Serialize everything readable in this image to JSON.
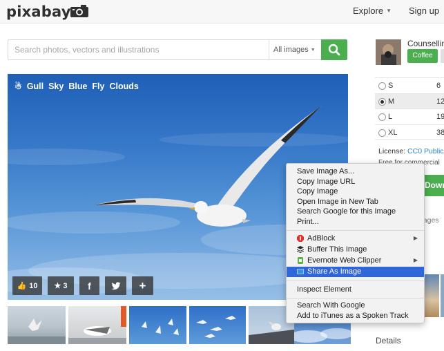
{
  "header": {
    "logo_text": "pixabay",
    "nav": {
      "explore_label": "Explore",
      "signup_label": "Sign up"
    }
  },
  "search": {
    "placeholder": "Search photos, vectors and illustrations",
    "type_label": "All images"
  },
  "image": {
    "tags": [
      "Gull",
      "Sky",
      "Blue",
      "Fly",
      "Clouds"
    ],
    "likes": "10",
    "favorites": "3",
    "facebook_label": "f",
    "add_label": "+"
  },
  "author": {
    "name": "Counsellin",
    "coffee_label": "Coffee"
  },
  "sizes": [
    {
      "label": "S",
      "value": "6"
    },
    {
      "label": "M",
      "value": "12"
    },
    {
      "label": "L",
      "value": "19"
    },
    {
      "label": "XL",
      "value": "38"
    }
  ],
  "selected_size": "M",
  "license": {
    "prefix": "License: ",
    "link": "CC0 Public",
    "note": "Free for commercial"
  },
  "download_label": "Downl",
  "related_label": "Sponsored images",
  "details_label": "Details",
  "context_menu": {
    "group1": [
      "Save Image As...",
      "Copy Image URL",
      "Copy Image",
      "Open Image in New Tab",
      "Search Google for this Image",
      "Print..."
    ],
    "extensions": [
      {
        "label": "AdBlock",
        "icon": "adblock-icon",
        "submenu": true
      },
      {
        "label": "Buffer This Image",
        "icon": "buffer-icon",
        "submenu": false
      },
      {
        "label": "Evernote Web Clipper",
        "icon": "evernote-icon",
        "submenu": true
      },
      {
        "label": "Share As Image",
        "icon": "share-as-image-icon",
        "submenu": false
      }
    ],
    "inspect": "Inspect Element",
    "group3": [
      "Search With Google",
      "Add to iTunes as a Spoken Track"
    ]
  },
  "colors": {
    "brand_green": "#4bae4f",
    "menu_highlight": "#2f66d9",
    "sky_top": "#1f5fb7",
    "sky_bottom": "#96bfe6"
  }
}
